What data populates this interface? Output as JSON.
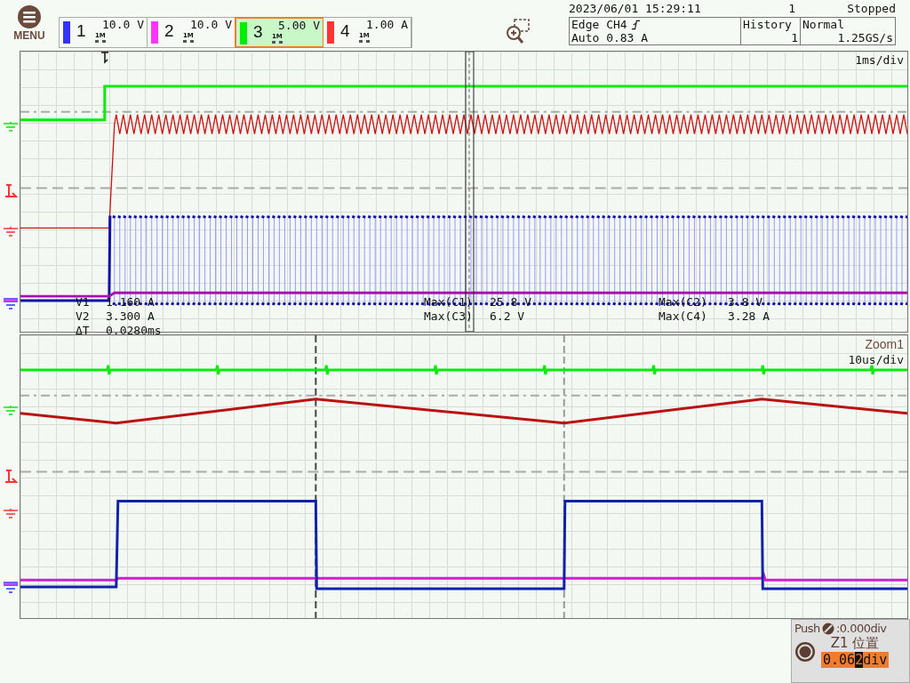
{
  "menu": {
    "label": "MENU"
  },
  "channels": [
    {
      "number": "1",
      "scale": "10.0 V",
      "probe": "1M",
      "color": "#3333ff",
      "selected": false
    },
    {
      "number": "2",
      "scale": "10.0 V",
      "probe": "1M",
      "color": "#ff33ff",
      "selected": false
    },
    {
      "number": "3",
      "scale": "5.00 V",
      "probe": "1M",
      "color": "#00ee00",
      "selected": true
    },
    {
      "number": "4",
      "scale": "1.00 A",
      "probe": "1M",
      "color": "#ff3333",
      "selected": false
    }
  ],
  "acquisition": {
    "datetime": "2023/06/01 15:29:11",
    "count": "1",
    "status": "Stopped",
    "trigger_type": "Edge CH4",
    "trigger_mode": "Auto 0.83 A",
    "history_label": "History",
    "history_count": "1",
    "mode": "Normal",
    "sample_rate": "1.25GS/s"
  },
  "main_plot": {
    "timebase": "1ms/div",
    "cursors": [
      {
        "label": "V1",
        "value": "1.160 A"
      },
      {
        "label": "V2",
        "value": "3.300 A"
      },
      {
        "label": "ΔT",
        "value": "0.0280ms"
      }
    ],
    "measurements": [
      {
        "label": "Max(C1)",
        "value": "25.8 V"
      },
      {
        "label": "Max(C2)",
        "value": "3.8 V"
      },
      {
        "label": "Max(C3)",
        "value": "6.2 V"
      },
      {
        "label": "Max(C4)",
        "value": "3.28 A"
      }
    ]
  },
  "zoom_plot": {
    "title": "Zoom1",
    "timebase": "10us/div"
  },
  "knob_panel": {
    "push_label": "Push",
    "push_value": ":0.000div",
    "label": "Z1 位置",
    "value_before": "0.06",
    "value_cursor": "2",
    "value_after": "div"
  }
}
